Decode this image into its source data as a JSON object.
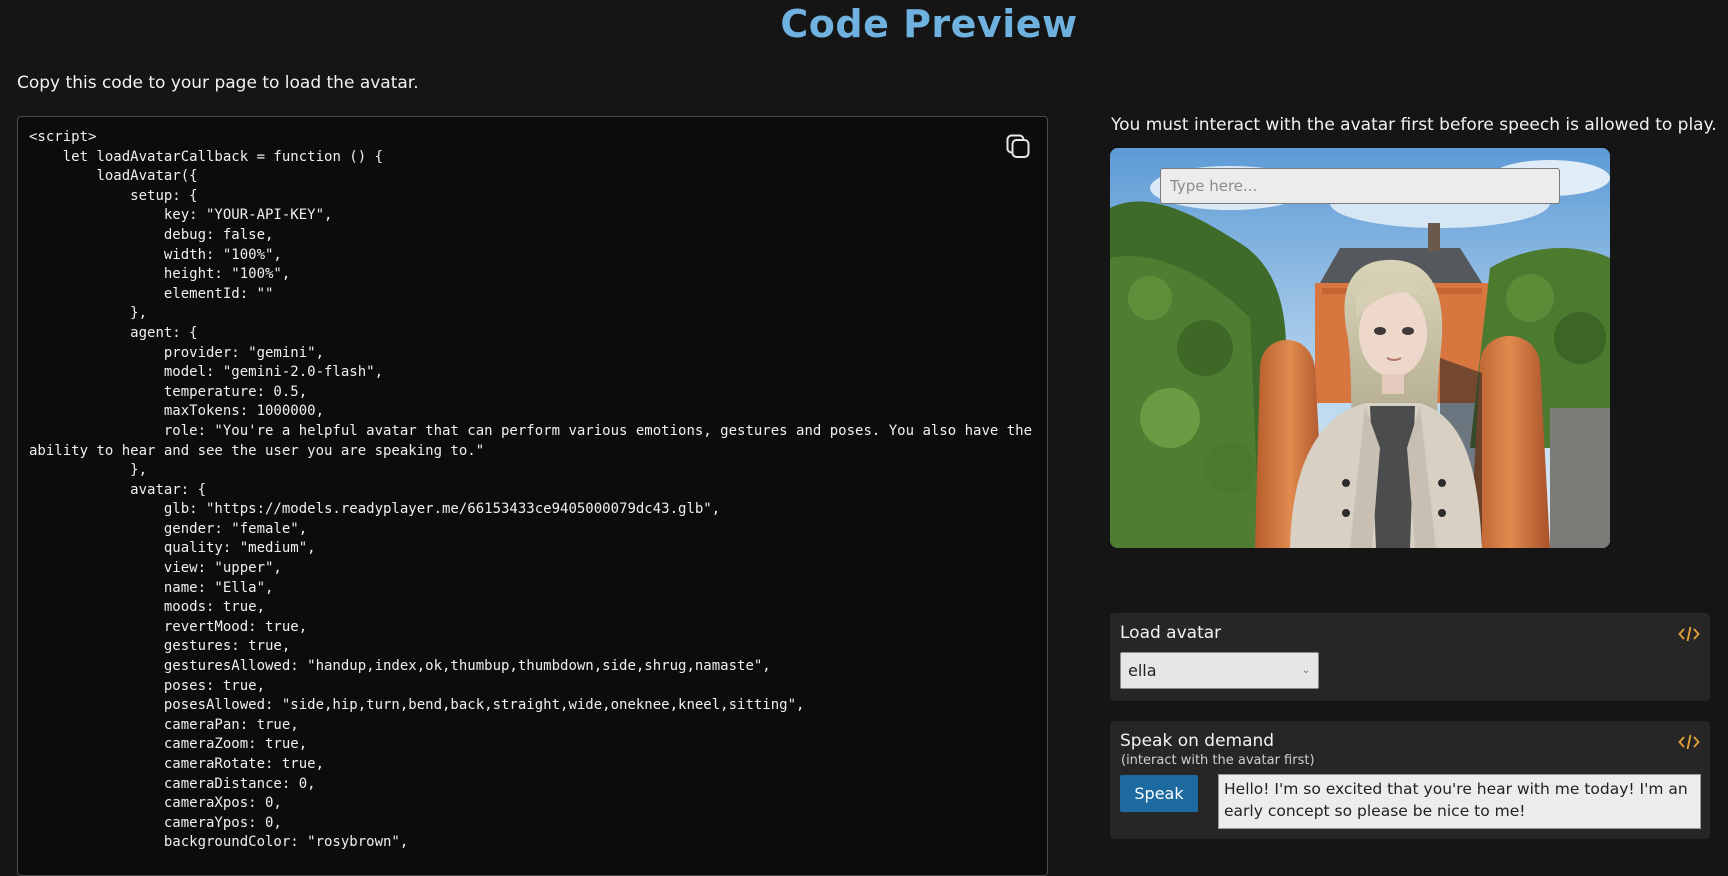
{
  "header": {
    "title": "Code Preview",
    "intro": "Copy this code to your page to load the avatar."
  },
  "code_panel": {
    "copy_icon": "copy-icon",
    "code": "<script>\n    let loadAvatarCallback = function () {\n        loadAvatar({\n            setup: {\n                key: \"YOUR-API-KEY\",\n                debug: false,\n                width: \"100%\",\n                height: \"100%\",\n                elementId: \"\"\n            },\n            agent: {\n                provider: \"gemini\",\n                model: \"gemini-2.0-flash\",\n                temperature: 0.5,\n                maxTokens: 1000000,\n                role: \"You're a helpful avatar that can perform various emotions, gestures and poses. You also have the ability to hear and see the user you are speaking to.\"\n            },\n            avatar: {\n                glb: \"https://models.readyplayer.me/66153433ce9405000079dc43.glb\",\n                gender: \"female\",\n                quality: \"medium\",\n                view: \"upper\",\n                name: \"Ella\",\n                moods: true,\n                revertMood: true,\n                gestures: true,\n                gesturesAllowed: \"handup,index,ok,thumbup,thumbdown,side,shrug,namaste\",\n                poses: true,\n                posesAllowed: \"side,hip,turn,bend,back,straight,wide,oneknee,kneel,sitting\",\n                cameraPan: true,\n                cameraZoom: true,\n                cameraRotate: true,\n                cameraDistance: 0,\n                cameraXpos: 0,\n                cameraYpos: 0,\n                backgroundColor: \"rosybrown\","
  },
  "avatar_preview": {
    "notice": "You must interact with the avatar first before speech is allowed to play.",
    "input_placeholder": "Type here..."
  },
  "load_avatar": {
    "title": "Load avatar",
    "selected": "ella",
    "code_icon": "code-tag-icon"
  },
  "speak_on_demand": {
    "title": "Speak on demand",
    "subtitle": "(interact with the avatar first)",
    "button_label": "Speak",
    "text": "Hello! I'm so excited that you're hear with me today! I'm an early concept so please be nice to me!",
    "code_icon": "code-tag-icon"
  },
  "colors": {
    "title": "#6fb2e0",
    "page_bg": "#151515",
    "code_bg": "#0c0c0c",
    "card_bg": "#262626",
    "button": "#1d6aa0",
    "code_icon": "#e8a33a"
  }
}
